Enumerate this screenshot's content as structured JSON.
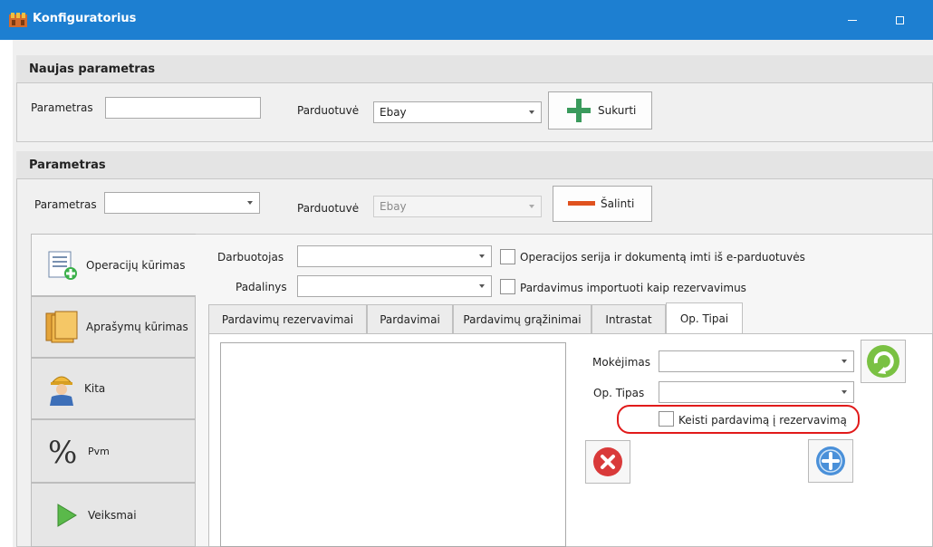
{
  "window": {
    "title": "Konfiguratorius"
  },
  "new_param": {
    "heading": "Naujas parametras",
    "param_label": "Parametras",
    "param_value": "",
    "store_label": "Parduotuvė",
    "store_value": "Ebay",
    "create_label": "Sukurti"
  },
  "param": {
    "heading": "Parametras",
    "param_label": "Parametras",
    "param_value": "",
    "store_label": "Parduotuvė",
    "store_value": "Ebay",
    "delete_label": "Šalinti"
  },
  "sidebar": {
    "items": [
      {
        "label": "Operacijų kūrimas",
        "icon": "document-add-icon"
      },
      {
        "label": "Aprašymų kūrimas",
        "icon": "books-icon"
      },
      {
        "label": "Kita",
        "icon": "worker-icon"
      },
      {
        "label": "Pvm",
        "icon": "percent-icon"
      },
      {
        "label": "Veiksmai",
        "icon": "play-icon"
      }
    ]
  },
  "operations": {
    "employee_label": "Darbuotojas",
    "employee_value": "",
    "division_label": "Padalinys",
    "division_value": "",
    "check_series": "Operacijos serija ir dokumentą imti iš e-parduotuvės",
    "check_import": "Pardavimus importuoti kaip rezervavimus"
  },
  "tabs": [
    "Pardavimų rezervavimai",
    "Pardavimai",
    "Pardavimų grąžinimai",
    "Intrastat",
    "Op. Tipai"
  ],
  "op_types": {
    "payment_label": "Mokėjimas",
    "payment_value": "",
    "type_label": "Op. Tipas",
    "type_value": "",
    "change_label": "Keisti pardavimą į rezervavimą"
  },
  "colors": {
    "titlebar": "#1d7fd1",
    "create_icon": "#3a9a5c",
    "delete_icon": "#e0521f",
    "highlight": "#e11a1a"
  }
}
